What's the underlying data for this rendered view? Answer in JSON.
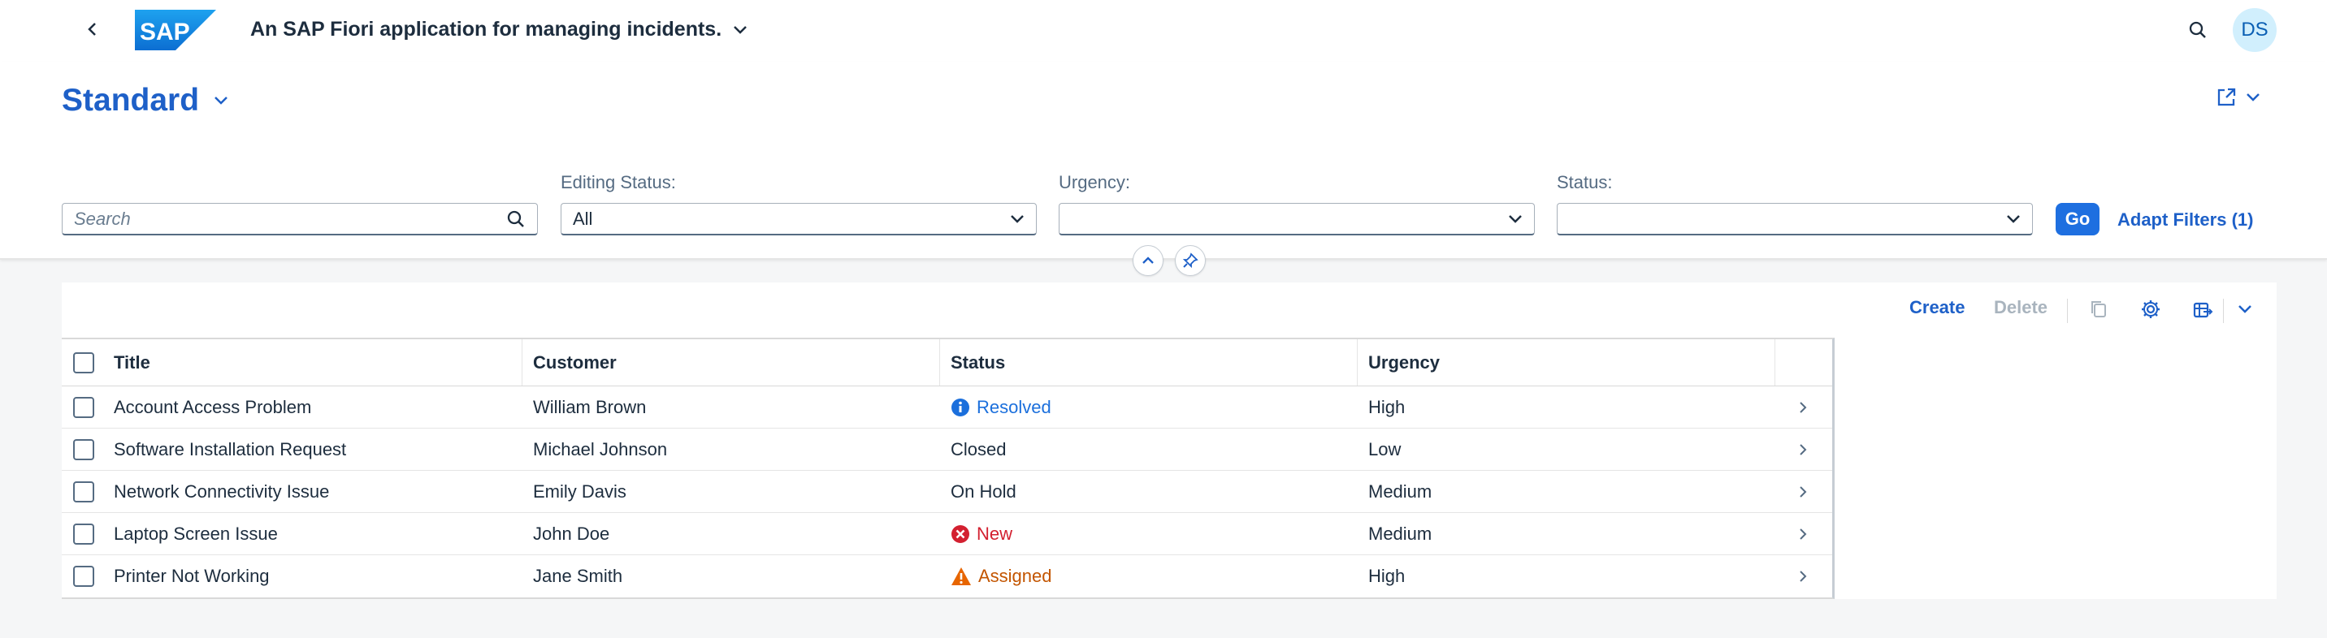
{
  "shell": {
    "app_title": "An SAP Fiori application for managing incidents.",
    "logo_text": "SAP",
    "user_initials": "DS"
  },
  "header": {
    "variant_title": "Standard"
  },
  "filters": {
    "search_placeholder": "Search",
    "editing_status": {
      "label": "Editing Status:",
      "value": "All"
    },
    "urgency": {
      "label": "Urgency:",
      "value": ""
    },
    "status": {
      "label": "Status:",
      "value": ""
    },
    "go_label": "Go",
    "adapt_label": "Adapt Filters (1)"
  },
  "toolbar": {
    "create_label": "Create",
    "delete_label": "Delete"
  },
  "table": {
    "columns": [
      "Title",
      "Customer",
      "Status",
      "Urgency"
    ],
    "rows": [
      {
        "title": "Account Access Problem",
        "customer": "William Brown",
        "status": "Resolved",
        "status_kind": "info",
        "urgency": "High"
      },
      {
        "title": "Software Installation Request",
        "customer": "Michael Johnson",
        "status": "Closed",
        "status_kind": "none",
        "urgency": "Low"
      },
      {
        "title": "Network Connectivity Issue",
        "customer": "Emily Davis",
        "status": "On Hold",
        "status_kind": "none",
        "urgency": "Medium"
      },
      {
        "title": "Laptop Screen Issue",
        "customer": "John Doe",
        "status": "New",
        "status_kind": "error",
        "urgency": "Medium"
      },
      {
        "title": "Printer Not Working",
        "customer": "Jane Smith",
        "status": "Assigned",
        "status_kind": "warning",
        "urgency": "High"
      }
    ]
  },
  "colors": {
    "brand_blue": "#1e60c8",
    "info": "#1b6fdc",
    "error": "#d32030",
    "warning": "#e76500"
  },
  "icons": {
    "back": "chevron-left-icon",
    "search": "search-icon",
    "share": "share-icon",
    "collapse": "chevron-up-icon",
    "pin": "pin-icon",
    "copy": "copy-icon",
    "settings": "gear-icon",
    "export": "export-icon",
    "row_nav": "chevron-right-icon"
  }
}
